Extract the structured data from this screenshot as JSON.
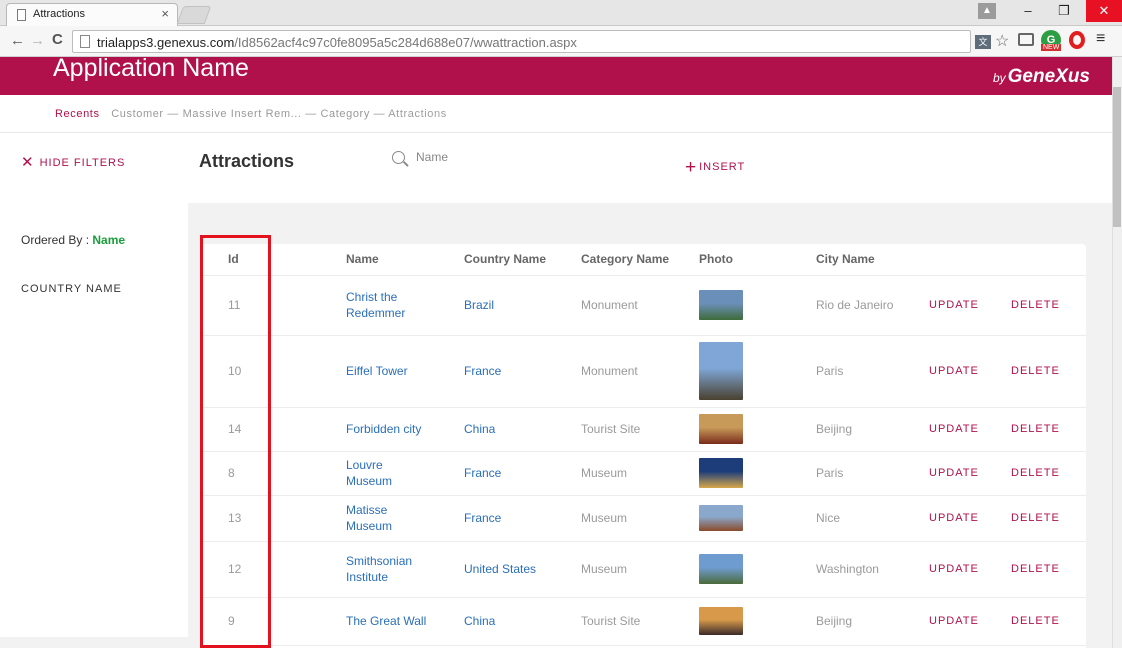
{
  "browser": {
    "tab_title": "Attractions",
    "tab_close": "×",
    "url_host": "trialapps3.genexus.com",
    "url_path": "/Id8562acf4c97c0fe8095a5c284d688e07/wwattraction.aspx",
    "window_min": "–",
    "window_max": "❐",
    "window_close": "✕",
    "back": "←",
    "forward": "→",
    "reload": "C",
    "menu": "≡"
  },
  "app": {
    "name": "Application Name",
    "brand_by": "by",
    "brand": "GeneXus"
  },
  "breadcrumb": {
    "recents": "Recents",
    "trail": "Customer — Massive Insert Rem... — Category —",
    "current": "Attractions"
  },
  "toolbar": {
    "hide_filters_icon": "✕",
    "hide_filters": "HIDE FILTERS",
    "title": "Attractions",
    "search_placeholder": "Name",
    "insert_icon": "+",
    "insert": "INSERT"
  },
  "filters": {
    "ordered_by_label": "Ordered By : ",
    "ordered_by_value": "Name",
    "country_filter": "COUNTRY NAME"
  },
  "grid": {
    "headers": {
      "id": "Id",
      "name": "Name",
      "country": "Country Name",
      "category": "Category Name",
      "photo": "Photo",
      "city": "City Name"
    },
    "rows": [
      {
        "id": "11",
        "name": "Christ the Redemmer",
        "country": "Brazil",
        "category": "Monument",
        "city": "Rio de Janeiro",
        "update": "UPDATE",
        "delete": "DELETE",
        "photo_colors": [
          "#6a8fb8",
          "#3e6b3a"
        ]
      },
      {
        "id": "10",
        "name": "Eiffel Tower",
        "country": "France",
        "category": "Monument",
        "city": "Paris",
        "update": "UPDATE",
        "delete": "DELETE",
        "photo_colors": [
          "#7fa6d6",
          "#4a4030"
        ]
      },
      {
        "id": "14",
        "name": "Forbidden city",
        "country": "China",
        "category": "Tourist Site",
        "city": "Beijing",
        "update": "UPDATE",
        "delete": "DELETE",
        "photo_colors": [
          "#c89a5a",
          "#7a2a1a"
        ]
      },
      {
        "id": "8",
        "name": "Louvre Museum",
        "country": "France",
        "category": "Museum",
        "city": "Paris",
        "update": "UPDATE",
        "delete": "DELETE",
        "photo_colors": [
          "#1d3d7a",
          "#d8a84a"
        ]
      },
      {
        "id": "13",
        "name": "Matisse Museum",
        "country": "France",
        "category": "Museum",
        "city": "Nice",
        "update": "UPDATE",
        "delete": "DELETE",
        "photo_colors": [
          "#8aa8cc",
          "#8a4a2a"
        ]
      },
      {
        "id": "12",
        "name": "Smithsonian Institute",
        "country": "United States",
        "category": "Museum",
        "city": "Washington",
        "update": "UPDATE",
        "delete": "DELETE",
        "photo_colors": [
          "#6f9cd0",
          "#4a6a3a"
        ]
      },
      {
        "id": "9",
        "name": "The Great Wall",
        "country": "China",
        "category": "Tourist Site",
        "city": "Beijing",
        "update": "UPDATE",
        "delete": "DELETE",
        "photo_colors": [
          "#d89a4a",
          "#3a2a2a"
        ]
      }
    ]
  },
  "colors": {
    "brand": "#b0114b",
    "link": "#2a6fb8",
    "highlight": "#e3121e",
    "ordered_value": "#1a9e3c"
  }
}
